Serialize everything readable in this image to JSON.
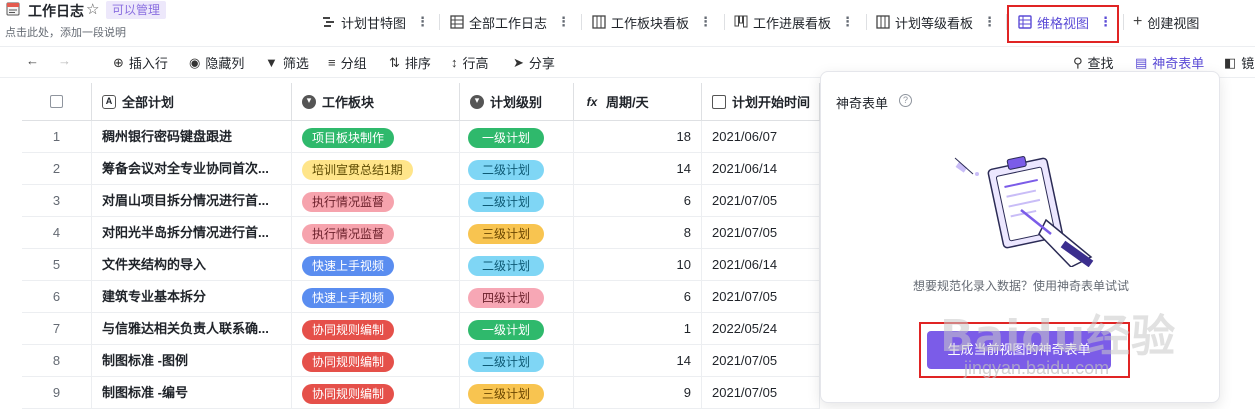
{
  "header": {
    "title": "工作日志",
    "permission_badge": "可以管理",
    "description_placeholder": "点击此处，添加一段说明",
    "star_icon": "star-icon"
  },
  "views": [
    {
      "label": "计划甘特图",
      "icon": "gantt-icon"
    },
    {
      "label": "全部工作日志",
      "icon": "table-icon"
    },
    {
      "label": "工作板块看板",
      "icon": "kanban-icon"
    },
    {
      "label": "工作进展看板",
      "icon": "kanban-icon"
    },
    {
      "label": "计划等级看板",
      "icon": "kanban-icon"
    },
    {
      "label": "维格视图",
      "icon": "grid-view-icon",
      "active": true
    }
  ],
  "create_view_label": "创建视图",
  "toolbar": {
    "insert_row": "插入行",
    "hide_columns": "隐藏列",
    "filter": "筛选",
    "group": "分组",
    "sort": "排序",
    "row_height": "行高",
    "share": "分享",
    "search": "查找",
    "magic_form": "神奇表单",
    "mirror": "镜"
  },
  "columns": [
    {
      "label": "全部计划",
      "icon": "text-field-icon"
    },
    {
      "label": "工作板块",
      "icon": "single-select-icon"
    },
    {
      "label": "计划级别",
      "icon": "single-select-icon"
    },
    {
      "label": "周期/天",
      "icon": "formula-icon"
    },
    {
      "label": "计划开始时间",
      "icon": "date-icon"
    }
  ],
  "rows": [
    {
      "n": "1",
      "plan": "稠州银行密码键盘跟进",
      "block": "项目板块制作",
      "block_color": "green",
      "level": "一级计划",
      "level_color": "green",
      "days": "18",
      "start": "2021/06/07"
    },
    {
      "n": "2",
      "plan": "筹备会议对全专业协同首次...",
      "block": "培训宣贯总结1期",
      "block_color": "yellow",
      "level": "二级计划",
      "level_color": "cyan",
      "days": "14",
      "start": "2021/06/14"
    },
    {
      "n": "3",
      "plan": "对眉山项目拆分情况进行首...",
      "block": "执行情况监督",
      "block_color": "pink",
      "level": "二级计划",
      "level_color": "cyan",
      "days": "6",
      "start": "2021/07/05"
    },
    {
      "n": "4",
      "plan": "对阳光半岛拆分情况进行首...",
      "block": "执行情况监督",
      "block_color": "pink",
      "level": "三级计划",
      "level_color": "orange",
      "days": "8",
      "start": "2021/07/05"
    },
    {
      "n": "5",
      "plan": "文件夹结构的导入",
      "block": "快速上手视频",
      "block_color": "blue",
      "level": "二级计划",
      "level_color": "cyan",
      "days": "10",
      "start": "2021/06/14"
    },
    {
      "n": "6",
      "plan": "建筑专业基本拆分",
      "block": "快速上手视频",
      "block_color": "blue",
      "level": "四级计划",
      "level_color": "rose",
      "days": "6",
      "start": "2021/07/05"
    },
    {
      "n": "7",
      "plan": "与信雅达相关负责人联系确...",
      "block": "协同规则编制",
      "block_color": "red",
      "level": "一级计划",
      "level_color": "green",
      "days": "1",
      "start": "2022/05/24"
    },
    {
      "n": "8",
      "plan": "制图标准 -图例",
      "block": "协同规则编制",
      "block_color": "red",
      "level": "二级计划",
      "level_color": "cyan",
      "days": "14",
      "start": "2021/07/05"
    },
    {
      "n": "9",
      "plan": "制图标准 -编号",
      "block": "协同规则编制",
      "block_color": "red",
      "level": "三级计划",
      "level_color": "orange",
      "days": "9",
      "start": "2021/07/05"
    }
  ],
  "panel": {
    "title": "神奇表单",
    "empty_text": "想要规范化录入数据？使用神奇表单试试",
    "button_label": "生成当前视图的神奇表单"
  },
  "watermark": {
    "text": "Baidu经验",
    "url_text": "jingyan.baidu.com"
  },
  "colors": {
    "accent": "#5b4bd6",
    "highlight_box": "#e02424",
    "button": "#7b5ce8"
  }
}
